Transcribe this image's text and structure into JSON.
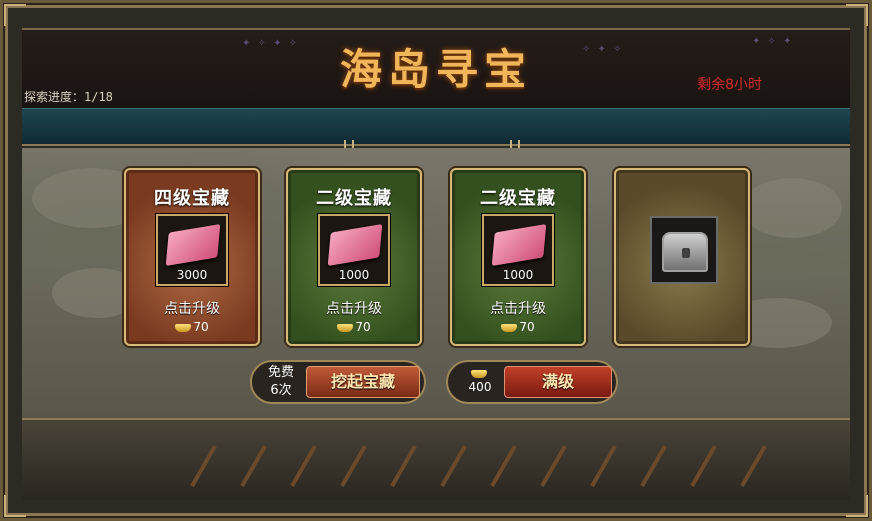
{
  "header": {
    "title": "海岛寻宝",
    "progress_label": "探索进度：1/18",
    "remaining_time": "剩余8小时"
  },
  "cards": [
    {
      "title": "四级宝藏",
      "quantity": "3000",
      "action_label": "点击升级",
      "cost": "70",
      "theme": "red",
      "item_icon": "silk-cloth-icon"
    },
    {
      "title": "二级宝藏",
      "quantity": "1000",
      "action_label": "点击升级",
      "cost": "70",
      "theme": "green",
      "item_icon": "silk-cloth-icon"
    },
    {
      "title": "二级宝藏",
      "quantity": "1000",
      "action_label": "点击升级",
      "cost": "70",
      "theme": "green",
      "item_icon": "silk-cloth-icon"
    },
    {
      "theme": "gold",
      "item_icon": "treasure-chest-icon"
    }
  ],
  "actions": {
    "free_label_line1": "免费",
    "free_label_line2": "6次",
    "dig_button_label": "挖起宝藏",
    "max_cost": "400",
    "max_button_label": "满级"
  },
  "colors": {
    "title_gold": "#f2b65a",
    "remaining_red": "#d82a2a",
    "teal_bar": "#1e4650",
    "card_border": "#d8b878"
  }
}
